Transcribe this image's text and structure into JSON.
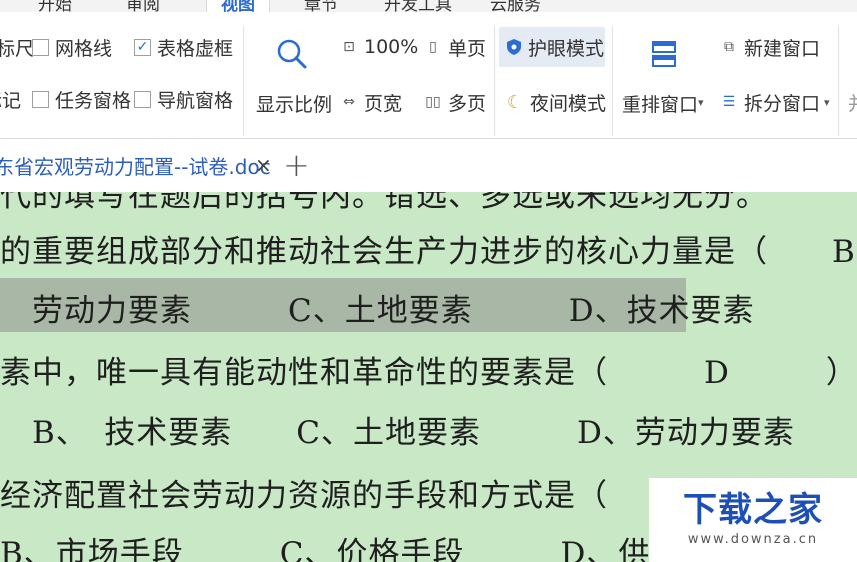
{
  "menu": {
    "tabs": [
      "开始",
      "审阅",
      "视图",
      "章节",
      "开发工具",
      "云服务"
    ],
    "active_index": 2
  },
  "ribbon": {
    "show_group": {
      "ruler": "标尺",
      "gridlines": "网格线",
      "table_gridlines": "表格虚框",
      "markup": "标记",
      "task_pane": "任务窗格",
      "nav_pane": "导航窗格",
      "table_gridlines_checked": true
    },
    "zoom_group": {
      "zoom": "显示比例",
      "percent": "100%",
      "page_width": "页宽",
      "one_page": "单页",
      "multi_page": "多页"
    },
    "mode_group": {
      "eye_care": "护眼模式",
      "night": "夜间模式"
    },
    "window_group": {
      "arrange": "重排窗口",
      "new_window": "新建窗口",
      "split": "拆分窗口",
      "more": "并"
    }
  },
  "tabs": {
    "doc_title": "东省宏观劳动力配置--试卷.doc",
    "close": "×",
    "new": "+"
  },
  "document": {
    "lines": [
      "代的填写在题后的括号内。错选、多选或未选均无分。",
      "的重要组成部分和推动社会生产力进步的核心力量是（　　B",
      "　劳动力要素　　　C、土地要素　　　D、技术要素",
      "素中，唯一具有能动性和革命性的要素是（　　　D　　　）",
      "　B、　技术要素　　C、土地要素　　　D、劳动力要素",
      "经济配置社会劳动力资源的手段和方式是（　　A　　　）",
      "B、市场手段　　　C、价格手段　　　D、供求机制"
    ]
  },
  "watermark": {
    "title": "下载之家",
    "url": "www.downza.cn"
  },
  "colors": {
    "eye_care_bg": "#c9e8c6",
    "accent": "#2b6cd4",
    "selection": "#a9b8a6"
  }
}
